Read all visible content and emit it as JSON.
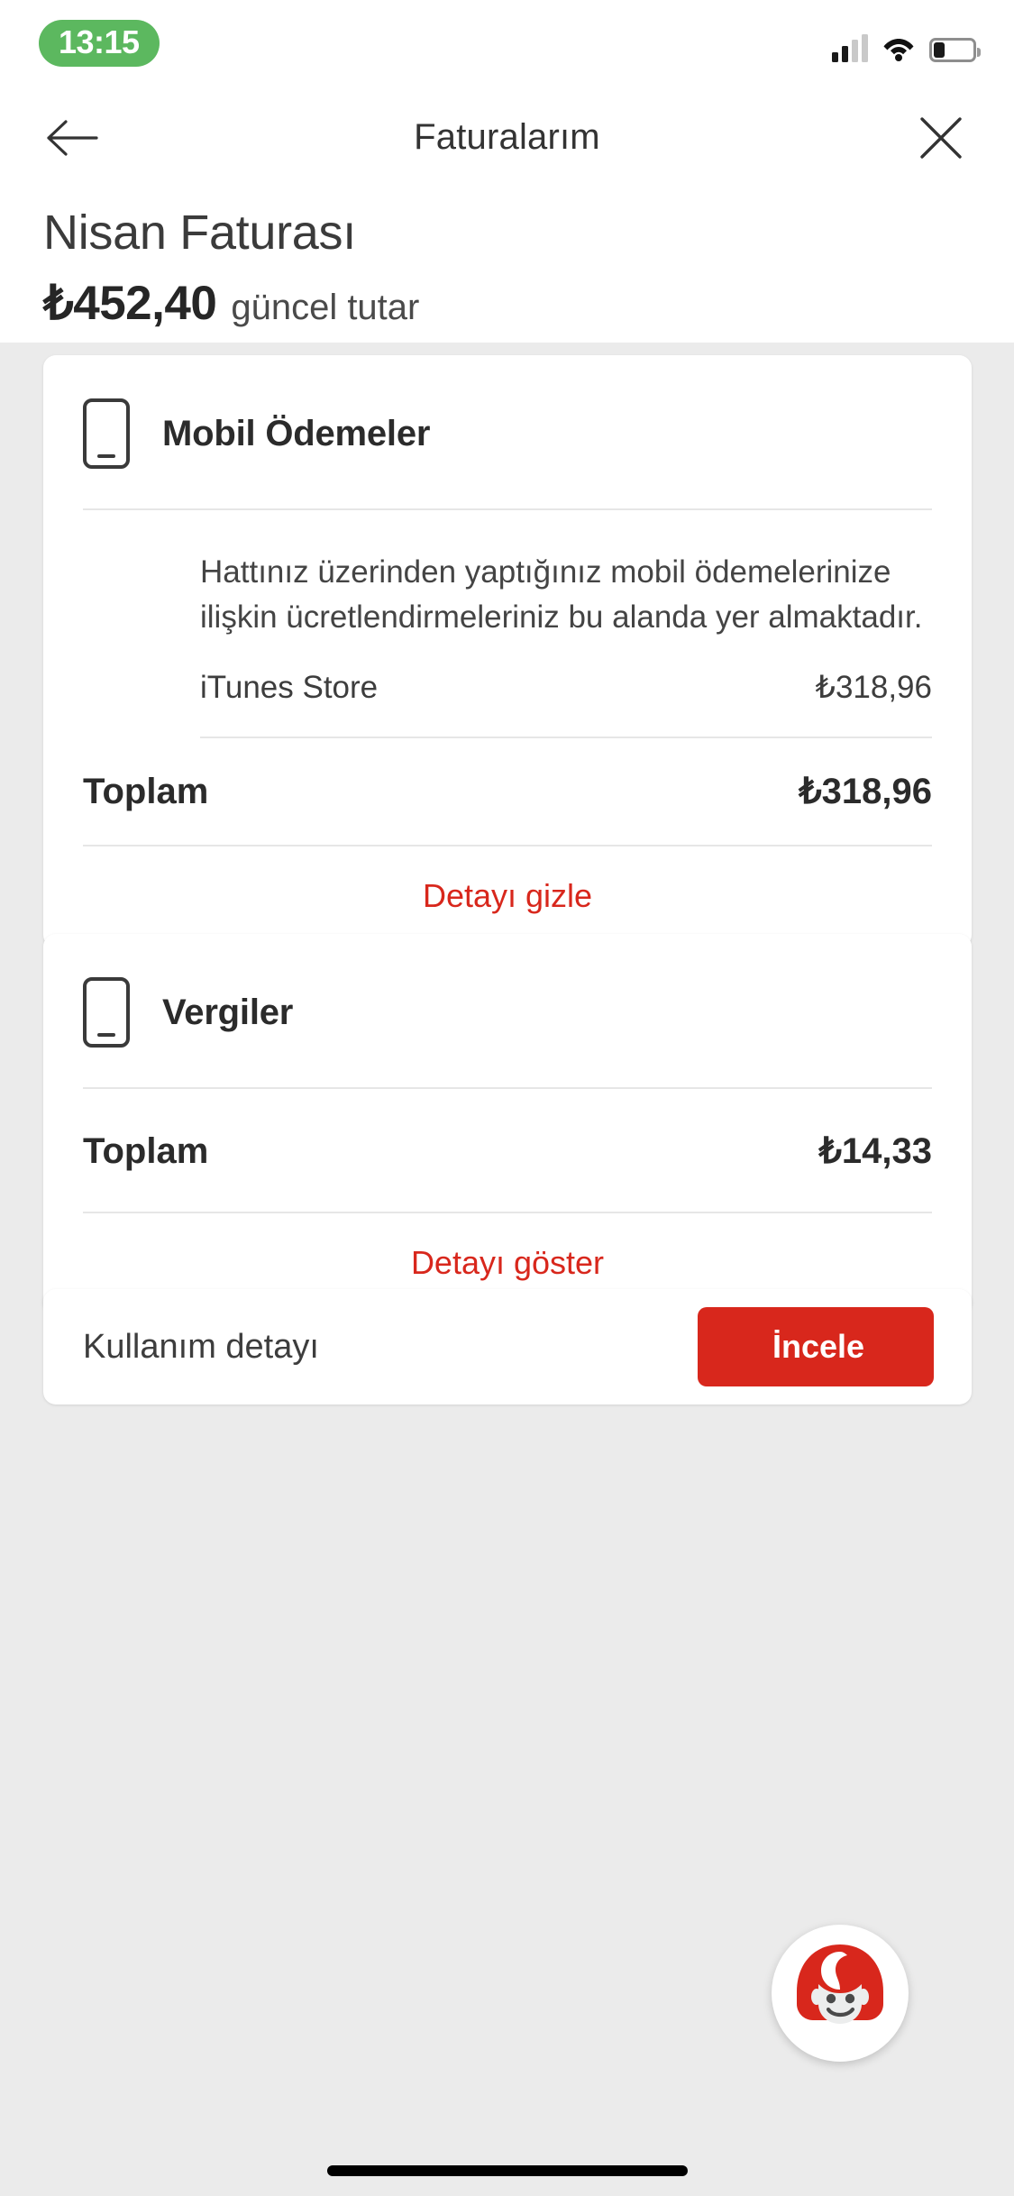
{
  "status_bar": {
    "time": "13:15",
    "signal_icon": "cellular-signal-icon",
    "wifi_icon": "wifi-icon",
    "battery_icon": "battery-icon"
  },
  "navbar": {
    "back_icon": "back-arrow-icon",
    "title": "Faturalarım",
    "close_icon": "close-icon"
  },
  "bill_header": {
    "month_title": "Nisan Faturası",
    "amount": "₺452,40",
    "amount_label": "güncel tutar"
  },
  "cards": [
    {
      "icon": "phone-icon",
      "title": "Mobil Ödemeler",
      "description": "Hattınız üzerinden yaptığınız mobil ödemelerinize ilişkin ücretlendirmeleriniz bu alanda yer almaktadır.",
      "items": [
        {
          "label": "iTunes  Store",
          "value": "₺318,96"
        }
      ],
      "total_label": "Toplam",
      "total_value": "₺318,96",
      "detail_link": "Detayı gizle"
    },
    {
      "icon": "phone-icon",
      "title": "Vergiler",
      "description": "",
      "items": [],
      "total_label": "Toplam",
      "total_value": "₺14,33",
      "detail_link": "Detayı göster"
    }
  ],
  "usage_row": {
    "label": "Kullanım detayı",
    "button_label": "İncele"
  },
  "assistant": {
    "name": "tobi-assistant-avatar"
  },
  "colors": {
    "brand_red": "#d8271c",
    "status_green": "#5cb85f",
    "background": "#ebebeb",
    "card": "#ffffff"
  }
}
